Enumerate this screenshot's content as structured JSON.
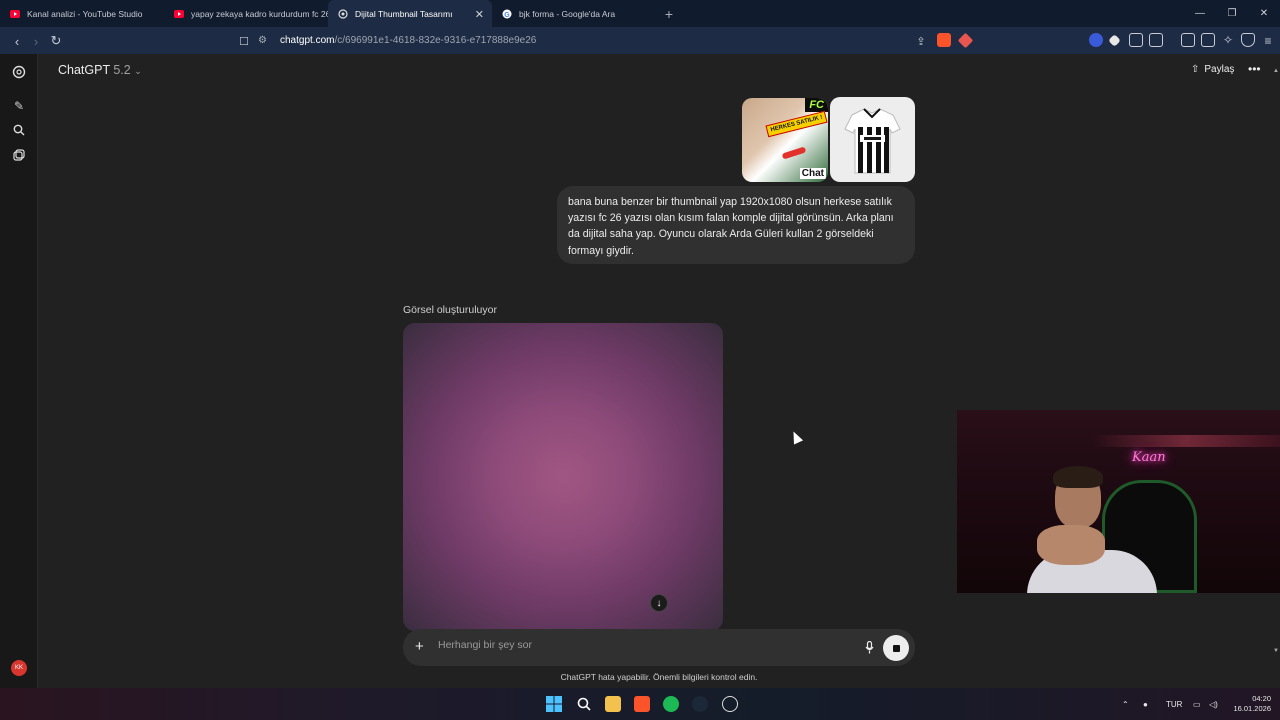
{
  "browser": {
    "tabs": [
      {
        "title": "Kanal analizi - YouTube Studio",
        "icon": "youtube-icon",
        "active": false
      },
      {
        "title": "yapay zekaya kadro kurdurdum fc 26",
        "icon": "youtube-icon",
        "active": false
      },
      {
        "title": "Dijital Thumbnail Tasarımı",
        "icon": "chatgpt-icon",
        "active": true
      },
      {
        "title": "bjk forma - Google'da Ara",
        "icon": "google-icon",
        "active": false
      }
    ],
    "url_host": "chatgpt.com",
    "url_path": "/c/696991e1-4618-832e-9316-e717888e9e26",
    "colors": {
      "tabbar": "#101b2d",
      "toolbar": "#1d2b44"
    }
  },
  "chat": {
    "model_name": "ChatGPT",
    "model_version": "5.2",
    "share_label": "Paylaş",
    "user_message": "bana buna benzer bir thumbnail yap 1920x1080 olsun herkese satılık yazısı fc 26 yazısı olan kısım falan komple dijital görünsün. Arka planı da dijital saha yap. Oyuncu olarak Arda Güleri kullan 2 görseldeki formayı giydir.",
    "attachment1": {
      "badge": "HERKES SATILIK !",
      "corner": "FC",
      "footer": "Chat"
    },
    "generating_label": "Görsel oluşturuluyor",
    "composer_placeholder": "Herhangi bir şey sor",
    "disclaimer": "ChatGPT hata yapabilir. Önemli bilgileri kontrol edin.",
    "avatar_initials": "KK",
    "accent": "#ececec"
  },
  "webcam": {
    "neon_text": "Kaan"
  },
  "taskbar": {
    "language": "TUR",
    "time": "04:20",
    "date": "16.01.2026"
  }
}
